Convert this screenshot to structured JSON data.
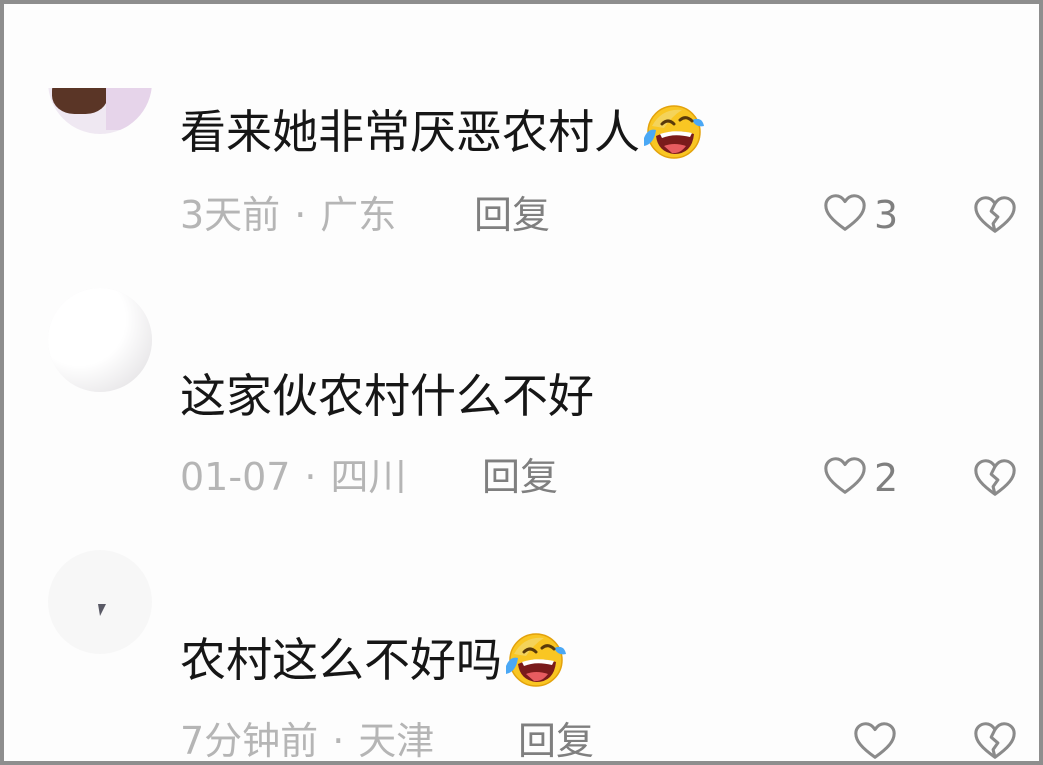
{
  "comments": [
    {
      "text": "看来她非常厌恶农村人",
      "emoji": "face-with-tears-of-joy",
      "time": "3天前",
      "location": "广东",
      "reply_label": "回复",
      "likes": "3"
    },
    {
      "text": "这家伙农村什么不好",
      "emoji": "",
      "time": "01-07",
      "location": "四川",
      "reply_label": "回复",
      "likes": "2"
    },
    {
      "text": "农村这么不好吗",
      "emoji": "face-with-tears-of-joy",
      "time": "7分钟前",
      "location": "天津",
      "reply_label": "回复",
      "likes": ""
    }
  ],
  "separator": "·",
  "colors": {
    "text": "#161616",
    "meta": "#b5b5b5",
    "secondary": "#7f7f7f",
    "icon_stroke": "#8a8a8a"
  }
}
